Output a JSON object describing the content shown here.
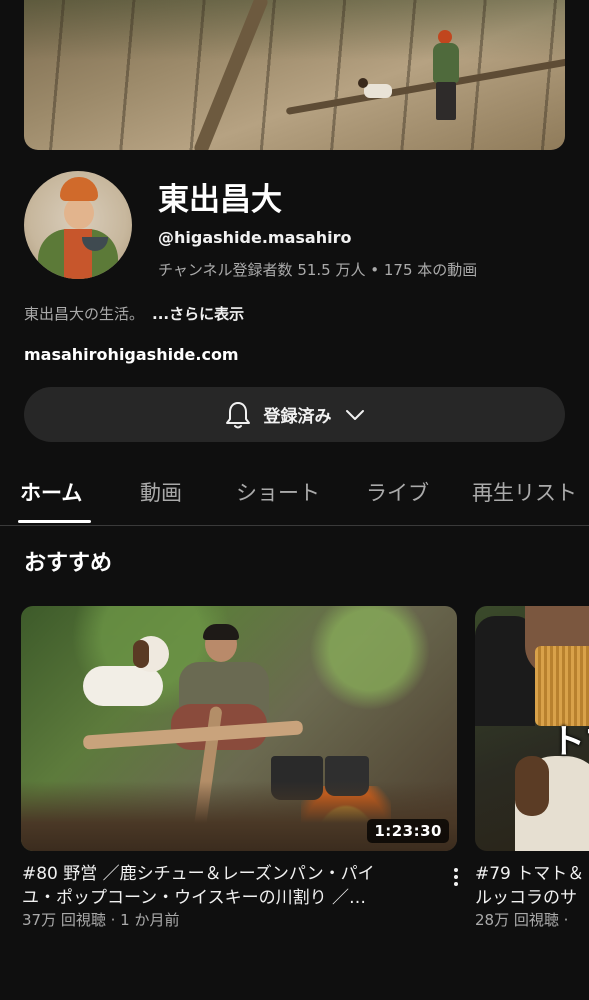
{
  "channel": {
    "name": "東出昌大",
    "handle": "@higashide.masahiro",
    "stats": "チャンネル登録者数 51.5 万人 • 175 本の動画",
    "description": "東出昌大の生活。",
    "more_label": "...さらに表示",
    "link": "masahirohigashide.com",
    "subscribe_label": "登録済み"
  },
  "tabs": [
    {
      "label": "ホーム",
      "active": true
    },
    {
      "label": "動画",
      "active": false
    },
    {
      "label": "ショート",
      "active": false
    },
    {
      "label": "ライブ",
      "active": false
    },
    {
      "label": "再生リスト",
      "active": false
    }
  ],
  "section": {
    "title": "おすすめ"
  },
  "videos": [
    {
      "title_line1": "#80 野営 ／鹿シチュー＆レーズンパン・パイ",
      "title_line2": "ユ・ポップコーン・ウイスキーの川割り ／…",
      "duration": "1:23:30",
      "meta": "37万 回視聴 · 1 か月前"
    },
    {
      "thumb_text": "トマ",
      "title_line1": "#79 トマト＆",
      "title_line2": "ルッコラのサ",
      "meta": "28万 回視聴 ·"
    }
  ],
  "colors": {
    "background": "#0f0f0f",
    "text_primary": "#f1f1f1",
    "text_secondary": "#aaaaaa",
    "button_bg": "#272727"
  }
}
